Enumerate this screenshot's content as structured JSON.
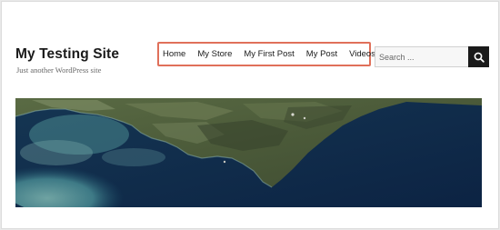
{
  "site": {
    "title": "My Testing Site",
    "tagline": "Just another WordPress site"
  },
  "nav": {
    "items": [
      {
        "label": "Home"
      },
      {
        "label": "My Store"
      },
      {
        "label": "My First Post"
      },
      {
        "label": "My Post"
      },
      {
        "label": "Videos"
      }
    ],
    "highlight_color": "#e0705a"
  },
  "search": {
    "placeholder": "Search ...",
    "value": "",
    "button_icon": "search-icon"
  },
  "hero": {
    "image": "satellite-coastline-image"
  },
  "colors": {
    "text": "#1a1a1a",
    "muted": "#686868",
    "search_button": "#1a1a1a",
    "page_background": "#e9e9e9"
  }
}
